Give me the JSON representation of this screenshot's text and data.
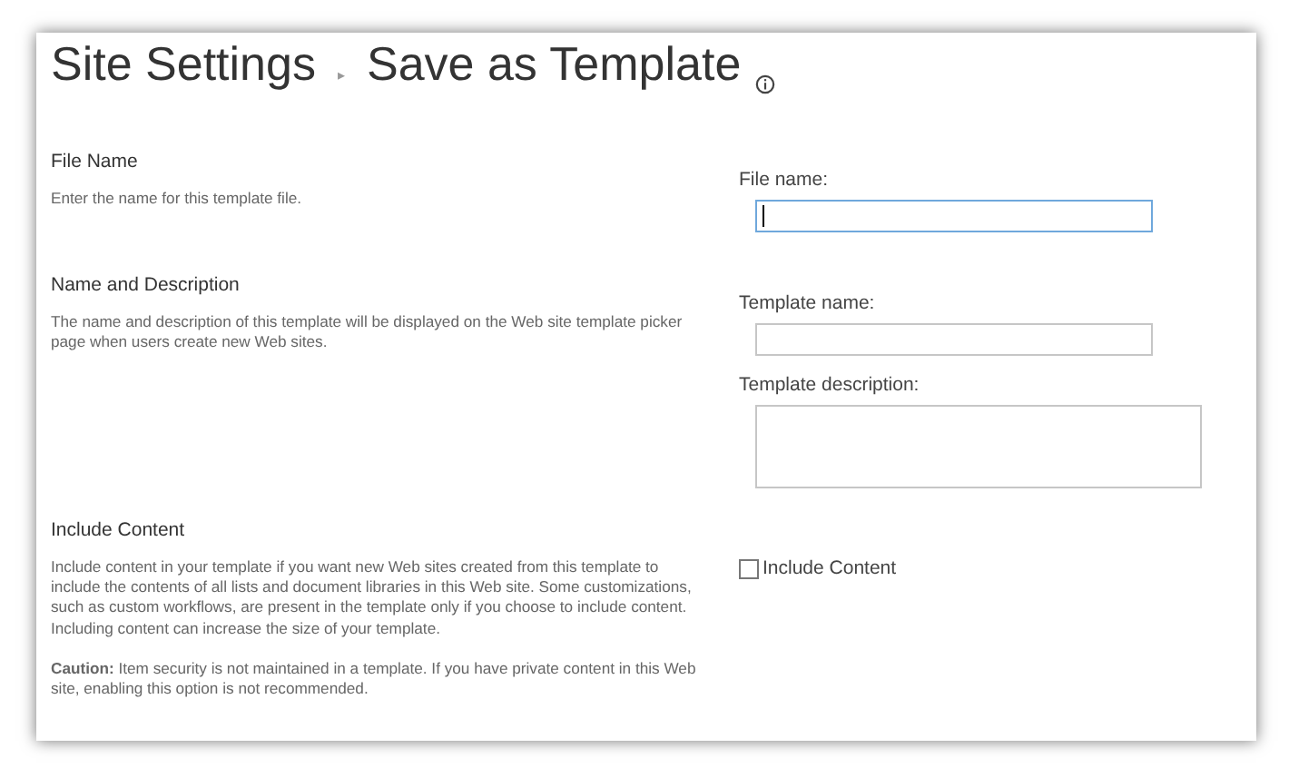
{
  "breadcrumb": {
    "parent": "Site Settings",
    "separator": "▸",
    "current": "Save as Template"
  },
  "sections": [
    {
      "title": "File Name",
      "paragraphs": [
        "Enter the name for this template file."
      ],
      "fields": [
        {
          "kind": "text",
          "label": "File name:",
          "focused": true
        }
      ]
    },
    {
      "title": "Name and Description",
      "paragraphs": [
        "The name and description of this template will be displayed on the Web site template picker page when users create new Web sites."
      ],
      "fields": [
        {
          "kind": "text",
          "label": "Template name:",
          "focused": false
        },
        {
          "kind": "textarea",
          "label": "Template description:",
          "focused": false
        }
      ]
    },
    {
      "title": "Include Content",
      "paragraphs": [
        "Include content in your template if you want new Web sites created from this template to include the contents of all lists and document libraries in this Web site. Some customizations, such as custom workflows, are present in the template only if you choose to include content. Including content can increase the size of your template.",
        "**Caution:** Item security is not maintained in a template. If you have private content in this Web site, enabling this option is not recommended."
      ],
      "fields": [
        {
          "kind": "checkbox",
          "label": "Include Content",
          "checked": false
        }
      ]
    }
  ]
}
